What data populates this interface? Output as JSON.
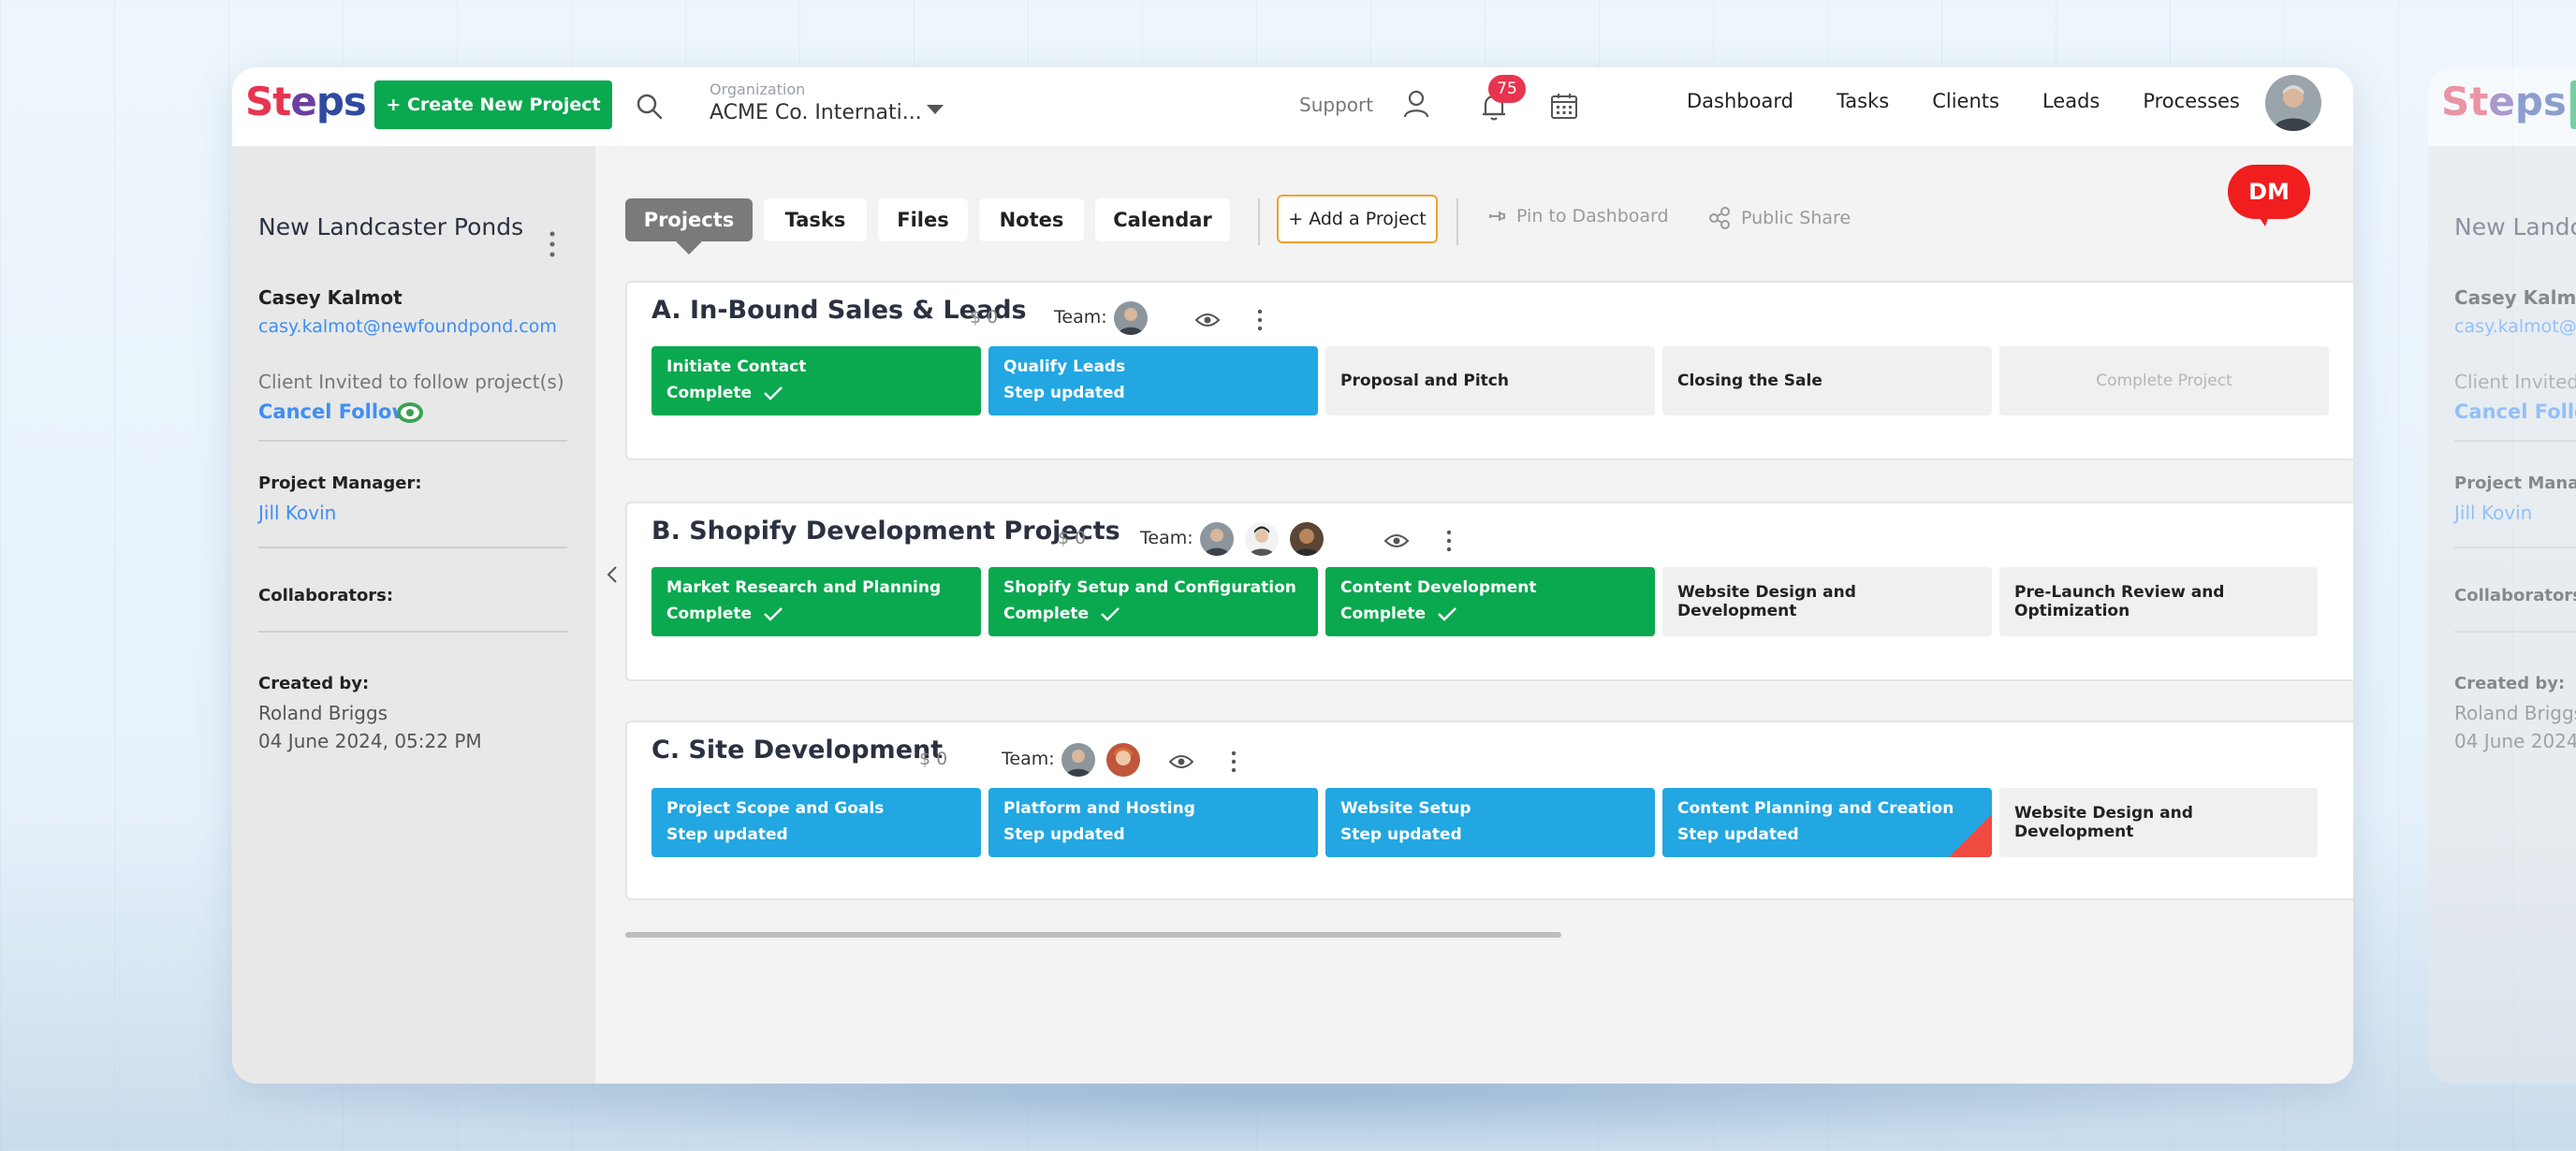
{
  "brand": {
    "logo_st": "St",
    "logo_e": "e",
    "logo_ps": "ps",
    "colors": {
      "primary_green": "#0aa84f",
      "step_blue": "#22a7e2",
      "alert_red": "#e8344f"
    }
  },
  "header": {
    "create_button": "+ Create New Project",
    "org_label": "Organization",
    "org_value": "ACME Co. Internati...",
    "support": "Support",
    "notification_count": "75",
    "nav": [
      "Dashboard",
      "Tasks",
      "Clients",
      "Leads",
      "Processes"
    ]
  },
  "sidebar": {
    "title": "New Landcaster Ponds",
    "client_name": "Casey Kalmot",
    "client_email": "casy.kalmot@newfoundpond.com",
    "invited_text": "Client Invited to follow project(s)",
    "cancel_follow": "Cancel Follow",
    "pm_label": "Project Manager:",
    "pm_name": "Jill Kovin",
    "collaborators_label": "Collaborators:",
    "created_label": "Created by:",
    "created_by": "Roland Briggs",
    "created_at": "04 June 2024, 05:22 PM"
  },
  "toolbar": {
    "tabs": [
      "Projects",
      "Tasks",
      "Files",
      "Notes",
      "Calendar"
    ],
    "active_tab": "Projects",
    "add_project": "+ Add a Project",
    "pin": "Pin to Dashboard",
    "share": "Public Share",
    "dm_badge": "DM"
  },
  "projects": [
    {
      "title": "A. In-Bound Sales & Leads",
      "amount": "$ 0",
      "team_label": "Team:",
      "steps": [
        {
          "name": "Initiate Contact",
          "status": "Complete",
          "kind": "green"
        },
        {
          "name": "Qualify Leads",
          "status": "Step updated",
          "kind": "blue"
        },
        {
          "name": "Proposal and Pitch",
          "status": "",
          "kind": "gray"
        },
        {
          "name": "Closing the Sale",
          "status": "",
          "kind": "gray"
        },
        {
          "name": "Complete Project",
          "status": "",
          "kind": "dim"
        }
      ]
    },
    {
      "title": "B. Shopify Development Projects",
      "amount": "$ 0",
      "team_label": "Team:",
      "steps": [
        {
          "name": "Market Research and Planning",
          "status": "Complete",
          "kind": "green"
        },
        {
          "name": "Shopify Setup and Configuration",
          "status": "Complete",
          "kind": "green"
        },
        {
          "name": "Content Development",
          "status": "Complete",
          "kind": "green"
        },
        {
          "name": "Website Design and Development",
          "status": "",
          "kind": "gray"
        },
        {
          "name": "Pre-Launch Review and Optimization",
          "status": "",
          "kind": "gray"
        }
      ]
    },
    {
      "title": "C. Site Development",
      "amount": "$ 0",
      "team_label": "Team:",
      "steps": [
        {
          "name": "Project Scope and Goals",
          "status": "Step updated",
          "kind": "blue"
        },
        {
          "name": "Platform and Hosting",
          "status": "Step updated",
          "kind": "blue"
        },
        {
          "name": "Website Setup",
          "status": "Step updated",
          "kind": "blue"
        },
        {
          "name": "Content Planning and Creation",
          "status": "Step updated",
          "kind": "blue"
        },
        {
          "name": "Website Design and Development",
          "status": "",
          "kind": "gray"
        }
      ]
    }
  ],
  "ghost": {
    "title": "New Landc",
    "client_name": "Casey Kalmot",
    "client_email": "casy.kalmot@n",
    "invited_text": "Client Invited t",
    "cancel_follow": "Cancel Follow",
    "pm_label": "Project Manag",
    "pm_name": "Jill Kovin",
    "collaborators_label": "Collaborators:",
    "created_label": "Created by:",
    "created_by": "Roland Briggs",
    "created_at": "04 June 2024,"
  }
}
